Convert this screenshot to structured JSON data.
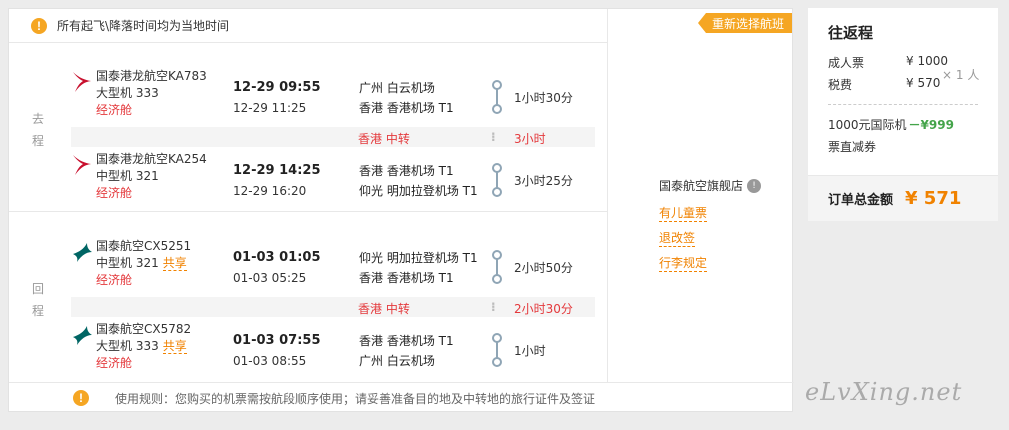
{
  "notice_top": "所有起飞\\降落时间均为当地时间",
  "reselect_label": "重新选择航班",
  "outbound": {
    "label_line1": "去",
    "label_line2": "程",
    "flights": [
      {
        "airline": "国泰港龙航空KA783",
        "model": "大型机 333",
        "share": "",
        "cabin": "经济舱",
        "dep_time": "12-29 09:55",
        "arr_time": "12-29 11:25",
        "dep_airport": "广州 白云机场",
        "arr_airport": "香港 香港机场 T1",
        "duration": "1小时30分"
      },
      {
        "airline": "国泰港龙航空KA254",
        "model": "中型机 321",
        "share": "",
        "cabin": "经济舱",
        "dep_time": "12-29 14:25",
        "arr_time": "12-29 16:20",
        "dep_airport": "香港 香港机场 T1",
        "arr_airport": "仰光 明加拉登机场 T1",
        "duration": "3小时25分"
      }
    ],
    "transfer": {
      "city": "香港 中转",
      "duration": "3小时"
    }
  },
  "return": {
    "label_line1": "回",
    "label_line2": "程",
    "flights": [
      {
        "airline": "国泰航空CX5251",
        "model": "中型机 321",
        "share": "共享",
        "cabin": "经济舱",
        "dep_time": "01-03 01:05",
        "arr_time": "01-03 05:25",
        "dep_airport": "仰光 明加拉登机场 T1",
        "arr_airport": "香港 香港机场 T1",
        "duration": "2小时50分"
      },
      {
        "airline": "国泰航空CX5782",
        "model": "大型机 333",
        "share": "共享",
        "cabin": "经济舱",
        "dep_time": "01-03 07:55",
        "arr_time": "01-03 08:55",
        "dep_airport": "香港 香港机场 T1",
        "arr_airport": "广州 白云机场",
        "duration": "1小时"
      }
    ],
    "transfer": {
      "city": "香港 中转",
      "duration": "2小时30分"
    }
  },
  "shop": {
    "name": "国泰航空旗舰店",
    "badge": "!"
  },
  "links": {
    "child_ticket": "有儿童票",
    "change_refund": "退改签",
    "baggage": "行李规定"
  },
  "notice_bottom": "使用规则：您购买的机票需按航段顺序使用；请妥善准备目的地及中转地的旅行证件及签证",
  "summary": {
    "title": "往返程",
    "adult_label": "成人票",
    "adult_price": "¥ 1000",
    "tax_label": "税费",
    "tax_price": "¥ 570",
    "multiplier": "× 1 人",
    "promo_label": "1000元国际机",
    "promo_amount": "－¥999",
    "promo_label2": "票直减券",
    "total_label": "订单总金额",
    "total_amount": "¥ 571"
  },
  "watermark": "eLvXing.net",
  "colors": {
    "accent": "#f08200",
    "red": "#e4393c",
    "warn": "#f5a623",
    "promo": "#44a44a",
    "cathay_green": "#006564",
    "dragon_red": "#c8102e"
  }
}
